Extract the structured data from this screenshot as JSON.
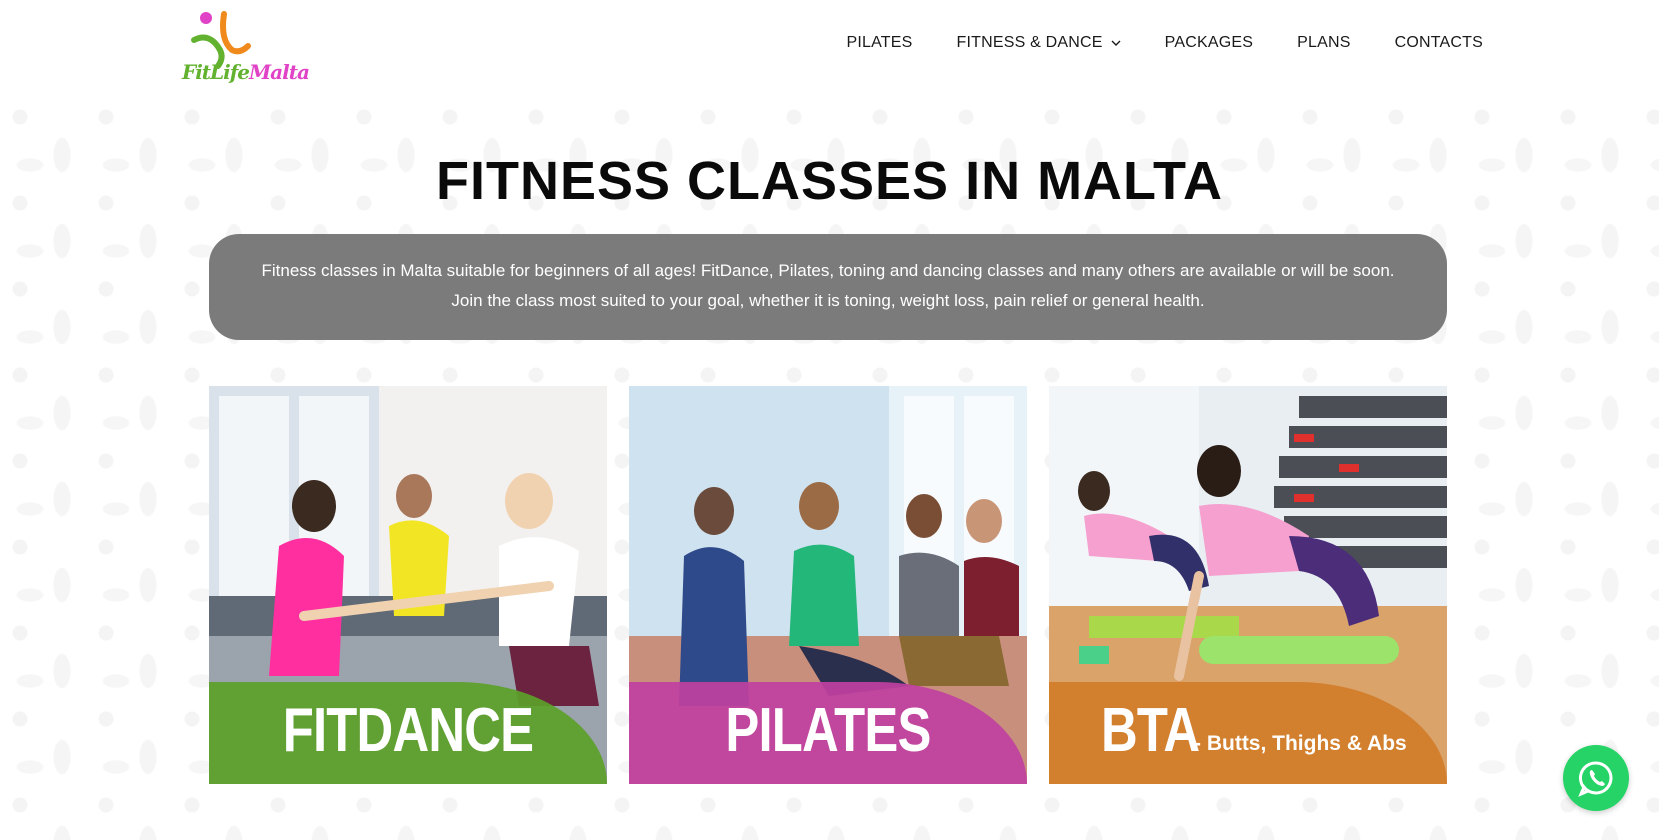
{
  "brand": {
    "logo_text_a": "FitLife",
    "logo_text_b": "Malta",
    "colors": {
      "green": "#62b22f",
      "orange": "#f08a1c",
      "pink": "#e043c6"
    }
  },
  "nav": {
    "items": [
      {
        "label": "PILATES"
      },
      {
        "label": "FITNESS & DANCE",
        "has_dropdown": true
      },
      {
        "label": "PACKAGES"
      },
      {
        "label": "PLANS"
      },
      {
        "label": "CONTACTS"
      }
    ]
  },
  "main": {
    "title": "FITNESS CLASSES IN MALTA",
    "intro_line_1": "Fitness classes in Malta suitable for beginners of all ages! FitDance, Pilates, toning and dancing classes and many others are available or will be soon.",
    "intro_line_2": "Join the class most suited to your goal, whether it is toning, weight loss, pain relief or general health."
  },
  "cards": [
    {
      "label": "FITDANCE",
      "accent": "#5d9f2a"
    },
    {
      "label": "PILATES",
      "accent": "#c0409f"
    },
    {
      "label": "BTA",
      "sublabel": "- Butts, Thighs & Abs",
      "accent": "#d17c2b"
    }
  ],
  "floating": {
    "icon": "whatsapp-icon",
    "color": "#25d366"
  }
}
